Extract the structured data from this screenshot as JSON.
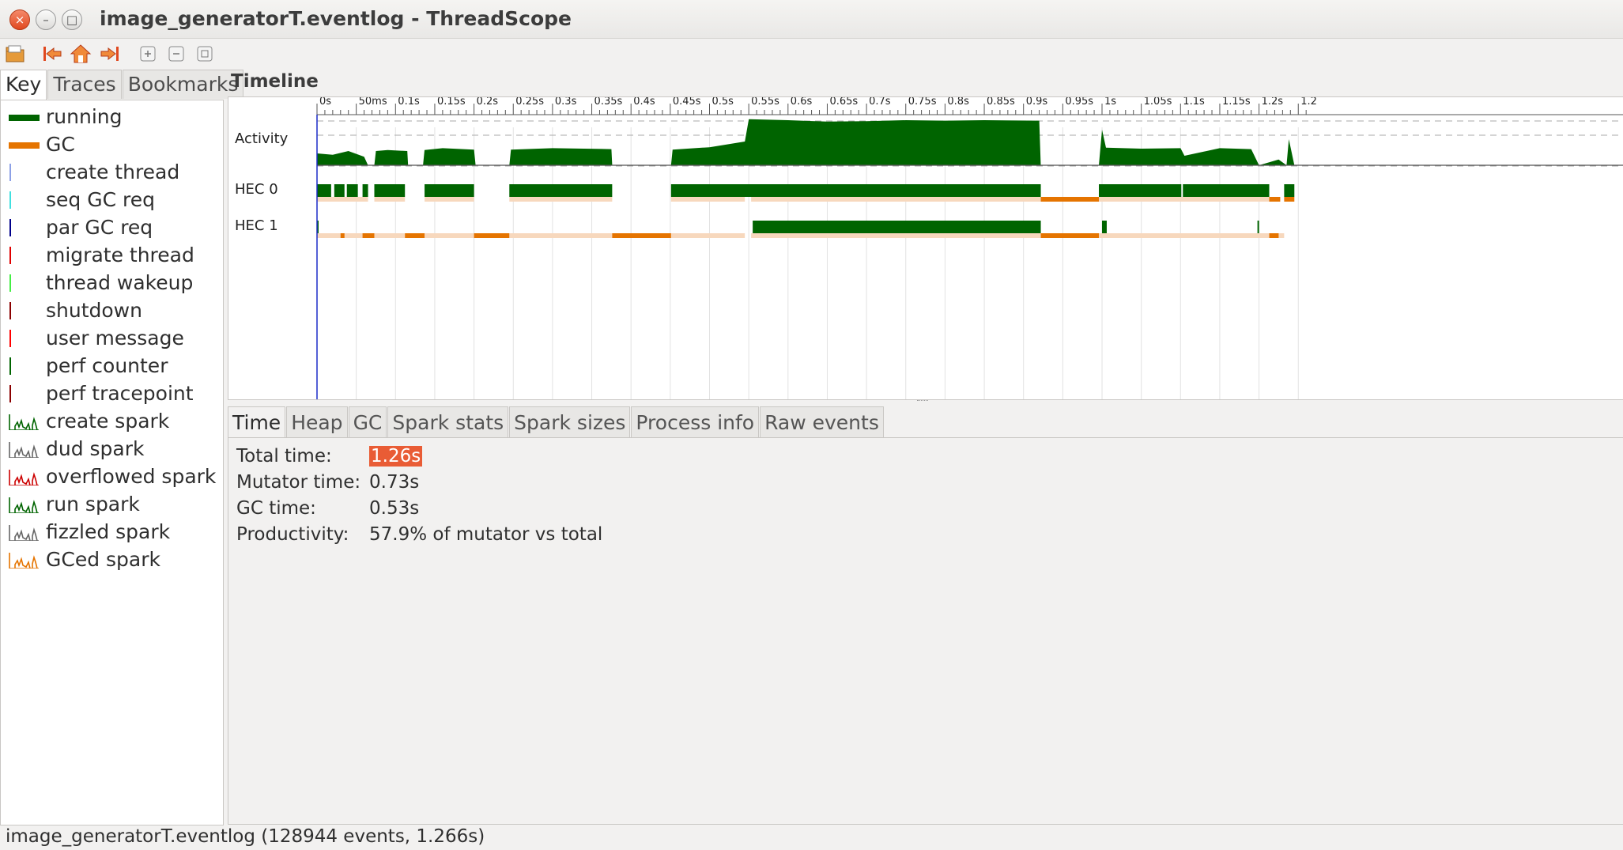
{
  "window": {
    "title": "image_generatorT.eventlog - ThreadScope"
  },
  "toolbar": {
    "icons": [
      "open-file-icon",
      "jump-start-icon",
      "home-icon",
      "jump-end-icon",
      "zoom-in-icon",
      "zoom-out-icon",
      "zoom-fit-icon"
    ]
  },
  "left_tabs": [
    "Key",
    "Traces",
    "Bookmarks"
  ],
  "key_items": [
    {
      "label": "running",
      "icon": "thick-bar",
      "color": "#006400"
    },
    {
      "label": "GC",
      "icon": "thick-bar",
      "color": "#e57400"
    },
    {
      "label": "create thread",
      "icon": "thin-line",
      "color": "#8ca0e6"
    },
    {
      "label": "seq GC req",
      "icon": "thin-line",
      "color": "#40e0e0"
    },
    {
      "label": "par GC req",
      "icon": "thin-line",
      "color": "#00008b"
    },
    {
      "label": "migrate thread",
      "icon": "thin-line",
      "color": "#e00000"
    },
    {
      "label": "thread wakeup",
      "icon": "thin-line",
      "color": "#44ee44"
    },
    {
      "label": "shutdown",
      "icon": "thin-line",
      "color": "#8b0000"
    },
    {
      "label": "user message",
      "icon": "thin-line",
      "color": "#ff0000"
    },
    {
      "label": "perf counter",
      "icon": "thin-line",
      "color": "#006400"
    },
    {
      "label": "perf tracepoint",
      "icon": "thin-line",
      "color": "#8b0000"
    },
    {
      "label": "create spark",
      "icon": "spark",
      "color": "#006400"
    },
    {
      "label": "dud spark",
      "icon": "spark",
      "color": "#666666"
    },
    {
      "label": "overflowed spark",
      "icon": "spark",
      "color": "#cc0000"
    },
    {
      "label": "run spark",
      "icon": "spark",
      "color": "#006400"
    },
    {
      "label": "fizzled spark",
      "icon": "spark",
      "color": "#666666"
    },
    {
      "label": "GCed spark",
      "icon": "spark",
      "color": "#e57400"
    }
  ],
  "timeline": {
    "heading": "Timeline",
    "tick_labels": [
      "0s",
      "50ms",
      "0.1s",
      "0.15s",
      "0.2s",
      "0.25s",
      "0.3s",
      "0.35s",
      "0.4s",
      "0.45s",
      "0.5s",
      "0.55s",
      "0.6s",
      "0.65s",
      "0.7s",
      "0.75s",
      "0.8s",
      "0.85s",
      "0.9s",
      "0.95s",
      "1s",
      "1.05s",
      "1.1s",
      "1.15s",
      "1.2s",
      "1.2"
    ],
    "rows": [
      "Activity",
      "HEC 0",
      "HEC 1"
    ],
    "colors": {
      "running": "#006400",
      "gc": "#e57400",
      "gc_light": "#f7d8bd",
      "cursor": "#1c2cc8"
    }
  },
  "chart_data": {
    "type": "area",
    "title": "Activity",
    "x_unit": "s",
    "xlim": [
      0,
      1.266
    ],
    "series": [
      {
        "values": [
          [
            0.0,
            0.25
          ],
          [
            0.02,
            0.22
          ],
          [
            0.04,
            0.3
          ],
          [
            0.06,
            0.18
          ],
          [
            0.065,
            0.0
          ],
          [
            0.073,
            0.0
          ],
          [
            0.075,
            0.3
          ],
          [
            0.09,
            0.32
          ],
          [
            0.115,
            0.3
          ],
          [
            0.116,
            0.0
          ],
          [
            0.135,
            0.0
          ],
          [
            0.137,
            0.32
          ],
          [
            0.16,
            0.36
          ],
          [
            0.2,
            0.33
          ],
          [
            0.202,
            0.0
          ],
          [
            0.245,
            0.0
          ],
          [
            0.247,
            0.33
          ],
          [
            0.3,
            0.36
          ],
          [
            0.375,
            0.34
          ],
          [
            0.376,
            0.0
          ],
          [
            0.451,
            0.0
          ],
          [
            0.453,
            0.33
          ],
          [
            0.5,
            0.38
          ],
          [
            0.545,
            0.5
          ],
          [
            0.55,
            0.97
          ],
          [
            0.6,
            0.95
          ],
          [
            0.65,
            0.92
          ],
          [
            0.7,
            0.93
          ],
          [
            0.75,
            0.95
          ],
          [
            0.8,
            0.94
          ],
          [
            0.85,
            0.95
          ],
          [
            0.92,
            0.94
          ],
          [
            0.922,
            0.0
          ],
          [
            0.996,
            0.0
          ],
          [
            1.0,
            0.75
          ],
          [
            1.005,
            0.37
          ],
          [
            1.05,
            0.35
          ],
          [
            1.1,
            0.36
          ],
          [
            1.105,
            0.2
          ],
          [
            1.15,
            0.36
          ],
          [
            1.19,
            0.34
          ],
          [
            1.2,
            0.0
          ],
          [
            1.225,
            0.12
          ],
          [
            1.235,
            0.0
          ],
          [
            1.238,
            0.55
          ],
          [
            1.245,
            0.0
          ],
          [
            1.266,
            0.0
          ]
        ]
      }
    ]
  },
  "bottom_tabs": [
    "Time",
    "Heap",
    "GC",
    "Spark stats",
    "Spark sizes",
    "Process info",
    "Raw events"
  ],
  "stats": [
    {
      "label": "Total time:",
      "value": "1.26s"
    },
    {
      "label": "Mutator time:",
      "value": "0.73s"
    },
    {
      "label": "GC time:",
      "value": "0.53s"
    },
    {
      "label": "Productivity:",
      "value": "57.9% of mutator vs total"
    }
  ],
  "status": "image_generatorT.eventlog (128944 events, 1.266s)"
}
